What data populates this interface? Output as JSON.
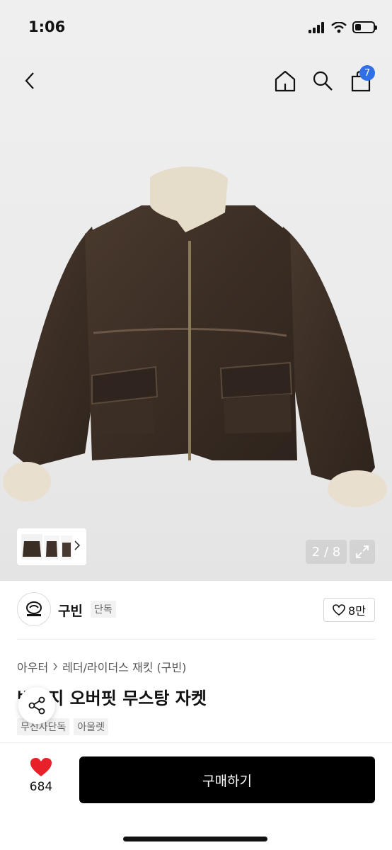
{
  "status_bar": {
    "time": "1:06"
  },
  "nav": {
    "cart_count": "7"
  },
  "gallery": {
    "counter": "2 / 8"
  },
  "brand": {
    "name": "구빈",
    "exclusive_tag": "단독",
    "like_count": "8만"
  },
  "breadcrumb": {
    "category": "아우터",
    "subcategory": "레더/라이더스 재킷 (구빈)"
  },
  "product": {
    "title": "빈티지 오버핏 무스탕 자켓",
    "tags": [
      "무신사단독",
      "아울렛"
    ]
  },
  "bottom_bar": {
    "like_count": "684",
    "buy_label": "구매하기"
  },
  "colors": {
    "accent_badge": "#2f6fe8",
    "heart": "#e8202a",
    "buy_button": "#000000"
  }
}
